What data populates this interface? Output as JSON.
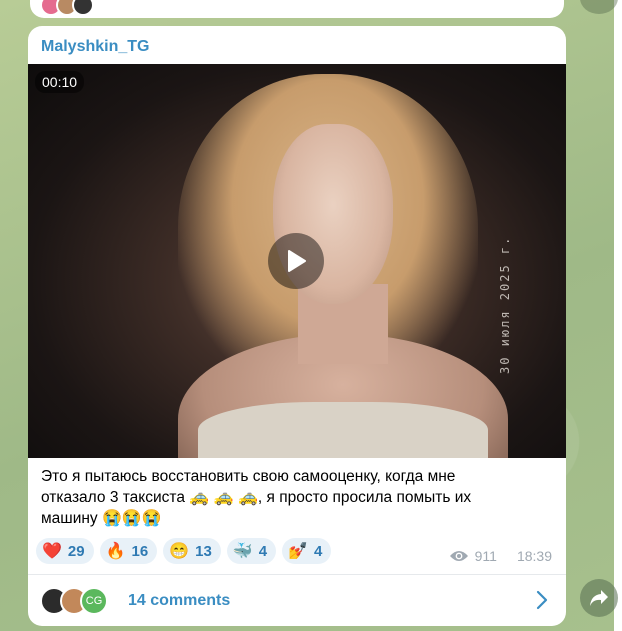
{
  "post": {
    "channel_name": "Malyshkin_TG",
    "video": {
      "duration": "00:10",
      "date_stamp": "30 июля 2025 г."
    },
    "caption": {
      "line1": "Это я пытаюсь восстановить свою самооценку, когда мне",
      "line2_part1": "отказало 3 таксиста",
      "taxi_emoji": "🚕 🚕 🚕",
      "line2_part2": ", я просто просила помыть их",
      "line3": "машину",
      "cry_emoji": "😭😭😭"
    },
    "reactions": [
      {
        "emoji": "❤️",
        "count": "29",
        "icon": "heart-icon"
      },
      {
        "emoji": "🔥",
        "count": "16",
        "icon": "fire-icon"
      },
      {
        "emoji": "😁",
        "count": "13",
        "icon": "grin-icon"
      },
      {
        "emoji": "🐳",
        "count": "4",
        "icon": "whale-icon"
      },
      {
        "emoji": "💅",
        "count": "4",
        "icon": "nail-polish-icon"
      }
    ],
    "views": "911",
    "time": "18:39",
    "comments": {
      "label": "14 comments",
      "avatar_initials": "CG"
    }
  },
  "colors": {
    "accent": "#3a8dc2",
    "reaction_bg": "#e8f1f8",
    "wallpaper": "#a9c18f"
  }
}
